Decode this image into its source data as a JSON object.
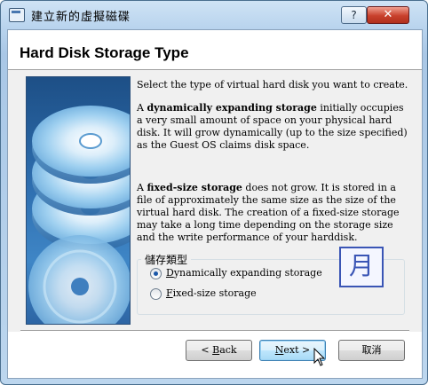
{
  "window": {
    "title": "建立新的虛擬磁碟",
    "help_glyph": "?",
    "close_glyph": "✕"
  },
  "header": {
    "title": "Hard Disk Storage Type"
  },
  "content": {
    "intro": "Select the type of virtual hard disk you want to create.",
    "dynamic_prefix": "A ",
    "dynamic_bold": "dynamically expanding storage",
    "dynamic_rest": " initially occupies a very small amount of space on your physical hard disk. It will grow dynamically (up to the size specified) as the Guest OS claims disk space.",
    "fixed_prefix": "A ",
    "fixed_bold": "fixed-size storage",
    "fixed_rest": " does not grow. It is stored in a file of approximately the same size as the size of the virtual hard disk. The creation of a fixed-size storage may take a long time depending on the storage size and the write performance of your harddisk."
  },
  "storage_group": {
    "title": "儲存類型",
    "options": [
      {
        "underlined": "D",
        "rest": "ynamically expanding storage",
        "selected": true
      },
      {
        "underlined": "F",
        "rest": "ixed-size storage",
        "selected": false
      }
    ]
  },
  "logo_glyph": "月",
  "buttons": {
    "back_prefix": "< ",
    "back_underlined": "B",
    "back_rest": "ack",
    "next_underlined": "N",
    "next_rest": "ext >",
    "cancel": "取消"
  },
  "icons": {
    "side_art": "stacked-disks-icon",
    "logo": "moon-char-logo-icon"
  },
  "colors": {
    "title_bar": "#b9d4ee",
    "close_button": "#c8402c",
    "side_image": "#2f6fb0",
    "radio_selected": "#1b57a8",
    "logo": "#3a55b5"
  }
}
